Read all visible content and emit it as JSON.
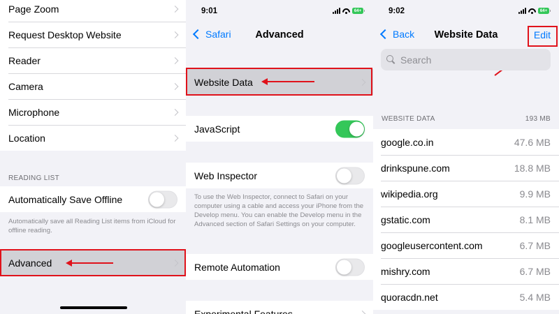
{
  "panel1": {
    "rows_top": [
      {
        "label": "Page Zoom",
        "icon": "chevron-right-icon"
      },
      {
        "label": "Request Desktop Website",
        "icon": "chevron-right-icon"
      },
      {
        "label": "Reader",
        "icon": "chevron-right-icon"
      },
      {
        "label": "Camera",
        "icon": "chevron-right-icon"
      },
      {
        "label": "Microphone",
        "icon": "chevron-right-icon"
      },
      {
        "label": "Location",
        "icon": "chevron-right-icon"
      }
    ],
    "reading_list_header": "READING LIST",
    "auto_save": {
      "label": "Automatically Save Offline",
      "on": false
    },
    "auto_save_footer": "Automatically save all Reading List items from iCloud for offline reading.",
    "advanced": {
      "label": "Advanced",
      "highlighted": true
    }
  },
  "panel2": {
    "time": "9:01",
    "battery": "64+",
    "back_label": "Safari",
    "title": "Advanced",
    "website_data": {
      "label": "Website Data",
      "highlighted": true
    },
    "javascript": {
      "label": "JavaScript",
      "on": true
    },
    "web_inspector": {
      "label": "Web Inspector",
      "on": false
    },
    "web_inspector_footer": "To use the Web Inspector, connect to Safari on your computer using a cable and access your iPhone from the Develop menu. You can enable the Develop menu in the Advanced section of Safari Settings on your computer.",
    "remote_automation": {
      "label": "Remote Automation",
      "on": false
    },
    "experimental": {
      "label": "Experimental Features"
    }
  },
  "panel3": {
    "time": "9:02",
    "battery": "64+",
    "back_label": "Back",
    "title": "Website Data",
    "edit_label": "Edit",
    "search_placeholder": "Search",
    "section_header": "WEBSITE DATA",
    "total_size": "193 MB",
    "sites": [
      {
        "domain": "google.co.in",
        "size": "47.6 MB"
      },
      {
        "domain": "drinkspune.com",
        "size": "18.8 MB"
      },
      {
        "domain": "wikipedia.org",
        "size": "9.9 MB"
      },
      {
        "domain": "gstatic.com",
        "size": "8.1 MB"
      },
      {
        "domain": "googleusercontent.com",
        "size": "6.7 MB"
      },
      {
        "domain": "mishry.com",
        "size": "6.7 MB"
      },
      {
        "domain": "quoracdn.net",
        "size": "5.4 MB"
      }
    ]
  },
  "colors": {
    "accent": "#007aff",
    "toggle_on": "#34c759",
    "annotation": "#e0121b",
    "highlight_row": "#d1d1d6"
  }
}
